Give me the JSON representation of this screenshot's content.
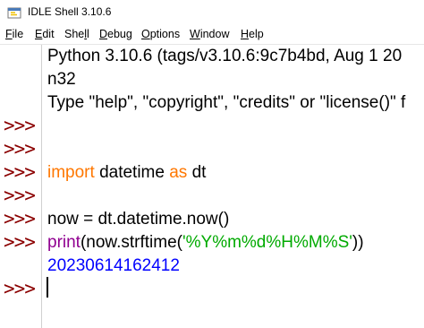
{
  "window": {
    "title": "IDLE Shell 3.10.6"
  },
  "menu": [
    {
      "mnemonic": "F",
      "rest": "ile"
    },
    {
      "mnemonic": "E",
      "rest": "dit"
    },
    {
      "pre": "She",
      "mnemonic": "l",
      "rest": "l"
    },
    {
      "mnemonic": "D",
      "rest": "ebug"
    },
    {
      "mnemonic": "O",
      "rest": "ptions"
    },
    {
      "mnemonic": "W",
      "rest": "indow"
    },
    {
      "mnemonic": "H",
      "rest": "elp"
    }
  ],
  "prompt": ">>>",
  "shell": {
    "banner1": "Python 3.10.6 (tags/v3.10.6:9c7b4bd, Aug  1 20",
    "banner2": "n32",
    "banner3": "Type \"help\", \"copyright\", \"credits\" or \"license()\" f",
    "import_kw": "import",
    "import_mod": " datetime ",
    "as_kw": "as",
    "import_alias": " dt",
    "assign_line": "now = dt.datetime.now()",
    "print_fn": "print",
    "print_mid": "(now.strftime(",
    "print_str": "'%Y%m%d%H%M%S'",
    "print_end": "))",
    "output": "20230614162412"
  }
}
